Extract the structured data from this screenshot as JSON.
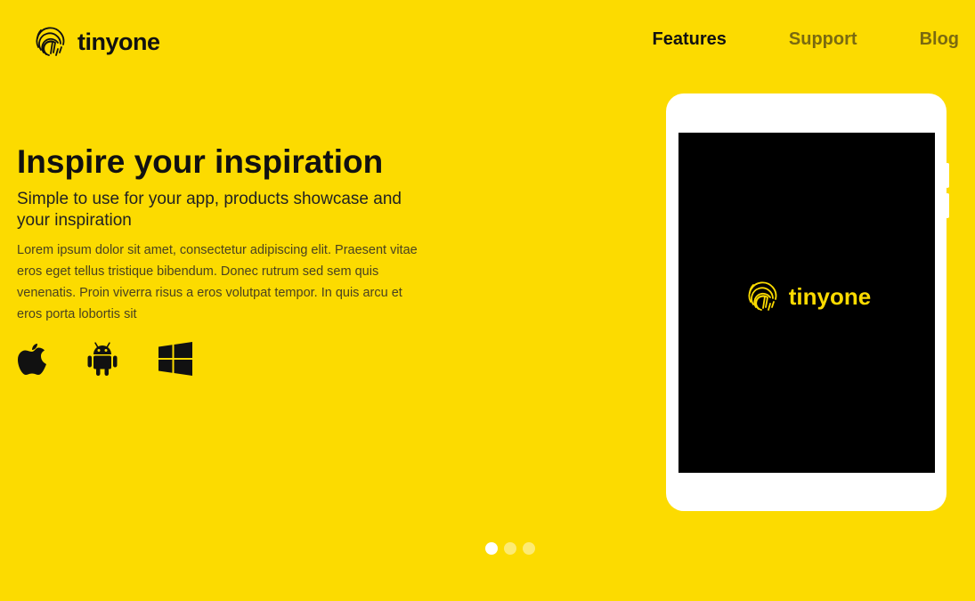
{
  "brand": {
    "name": "tinyone",
    "logo_icon": "fingerprint-icon",
    "accent": "#FCDB00"
  },
  "nav": {
    "items": [
      {
        "label": "Features",
        "active": true
      },
      {
        "label": "Support",
        "active": false
      },
      {
        "label": "Blog",
        "active": false
      }
    ]
  },
  "hero": {
    "title": "Inspire your inspiration",
    "subtitle": "Simple to use for your app, products showcase and your inspiration",
    "body": "Lorem ipsum dolor sit amet, consectetur adipiscing elit. Praesent vitae eros eget tellus tristique bibendum. Donec rutrum sed sem quis venenatis. Proin viverra risus a eros volutpat tempor. In quis arcu et eros porta lobortis sit",
    "platform_icons": [
      "apple-icon",
      "android-icon",
      "windows-icon"
    ]
  },
  "device": {
    "screen_brand": "tinyone"
  },
  "carousel": {
    "slide_count": 3,
    "active_index": 0
  }
}
